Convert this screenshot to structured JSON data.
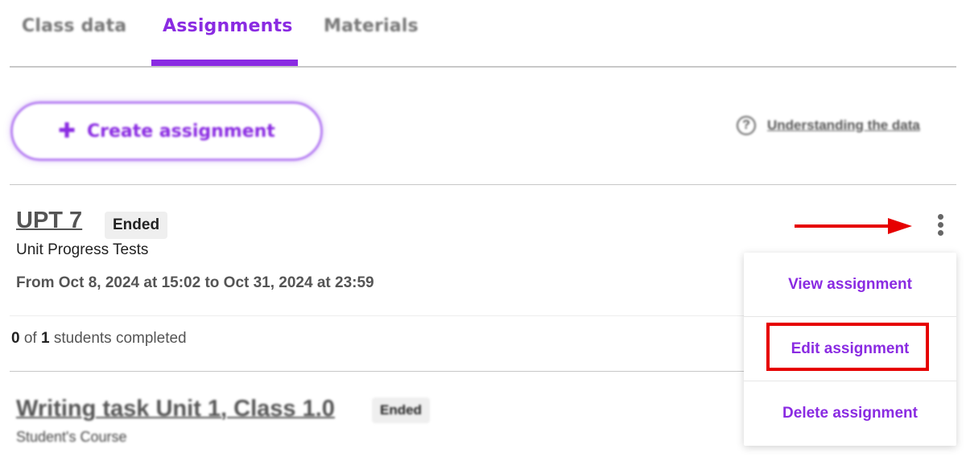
{
  "tabs": [
    {
      "label": "Class data"
    },
    {
      "label": "Assignments"
    },
    {
      "label": "Materials"
    }
  ],
  "toolbar": {
    "create_label": "Create assignment",
    "help_label": "Understanding the data"
  },
  "assignments": [
    {
      "title": "UPT 7",
      "status": "Ended",
      "course": "Unit Progress Tests",
      "dates": "From Oct 8, 2024 at 15:02 to Oct 31, 2024 at 23:59",
      "completed": "0",
      "of_text": "of",
      "total": "1",
      "students_text": "students completed"
    },
    {
      "title": "Writing task Unit 1, Class 1.0",
      "status": "Ended",
      "course": "Student's Course"
    }
  ],
  "menu": {
    "items": [
      {
        "label": "View assignment"
      },
      {
        "label": "Edit assignment"
      },
      {
        "label": "Delete assignment"
      }
    ]
  },
  "colors": {
    "accent": "#8a2be2",
    "annotation": "#e60000"
  }
}
